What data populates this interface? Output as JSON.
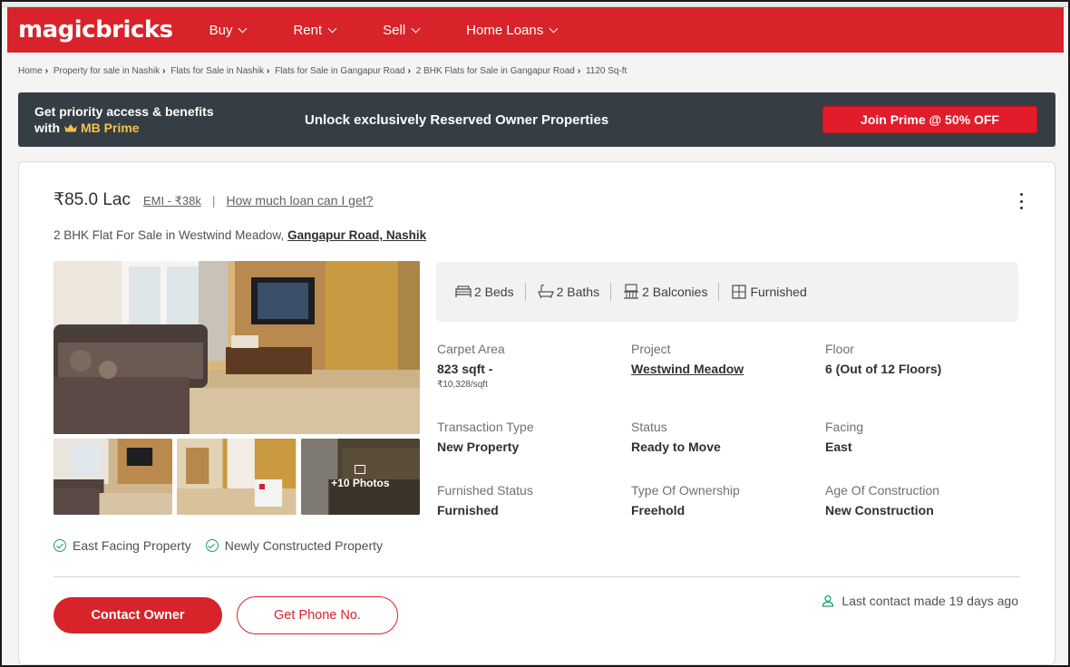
{
  "header": {
    "logo": "magicbricks",
    "nav": [
      {
        "label": "Buy"
      },
      {
        "label": "Rent"
      },
      {
        "label": "Sell"
      },
      {
        "label": "Home Loans"
      }
    ]
  },
  "breadcrumb": [
    "Home",
    "Property for sale in Nashik",
    "Flats for Sale in Nashik",
    "Flats for Sale in Gangapur Road",
    "2 BHK Flats for Sale in Gangapur Road",
    "1120 Sq-ft"
  ],
  "prime_banner": {
    "line1": "Get priority access & benefits",
    "line2_prefix": "with",
    "brand": "MB Prime",
    "message": "Unlock exclusively Reserved Owner Properties",
    "cta": "Join Prime @ 50% OFF"
  },
  "listing": {
    "price": "₹85.0 Lac",
    "emi": "EMI - ₹38k",
    "separator": "|",
    "loan_link": "How much loan can I get?",
    "title": "2 BHK Flat For Sale in Westwind Meadow,",
    "location": "Gangapur Road, Nashik",
    "more_photos": "+10 Photos",
    "summary": [
      {
        "label": "2 Beds",
        "icon": "bed-icon"
      },
      {
        "label": "2 Baths",
        "icon": "bath-icon"
      },
      {
        "label": "2 Balconies",
        "icon": "balcony-icon"
      },
      {
        "label": "Furnished",
        "icon": "furniture-icon"
      }
    ],
    "details": [
      {
        "label": "Carpet Area",
        "value": "823 sqft -",
        "sub": "₹10,328/sqft"
      },
      {
        "label": "Project",
        "value": "Westwind Meadow"
      },
      {
        "label": "Floor",
        "value": "6 (Out of 12 Floors)"
      },
      {
        "label": "Transaction Type",
        "value": "New Property"
      },
      {
        "label": "Status",
        "value": "Ready to Move"
      },
      {
        "label": "Facing",
        "value": "East"
      },
      {
        "label": "Furnished Status",
        "value": "Furnished"
      },
      {
        "label": "Type Of Ownership",
        "value": "Freehold"
      },
      {
        "label": "Age Of Construction",
        "value": "New Construction"
      }
    ],
    "tags": [
      "East Facing Property",
      "Newly Constructed Property"
    ],
    "contact_button": "Contact Owner",
    "phone_button": "Get Phone No.",
    "last_contact": "Last contact made 19 days ago"
  },
  "colors": {
    "brand_red": "#d8232a",
    "prime_bg": "#353e45",
    "prime_gold": "#f6c14b",
    "check_green": "#1da06f"
  }
}
